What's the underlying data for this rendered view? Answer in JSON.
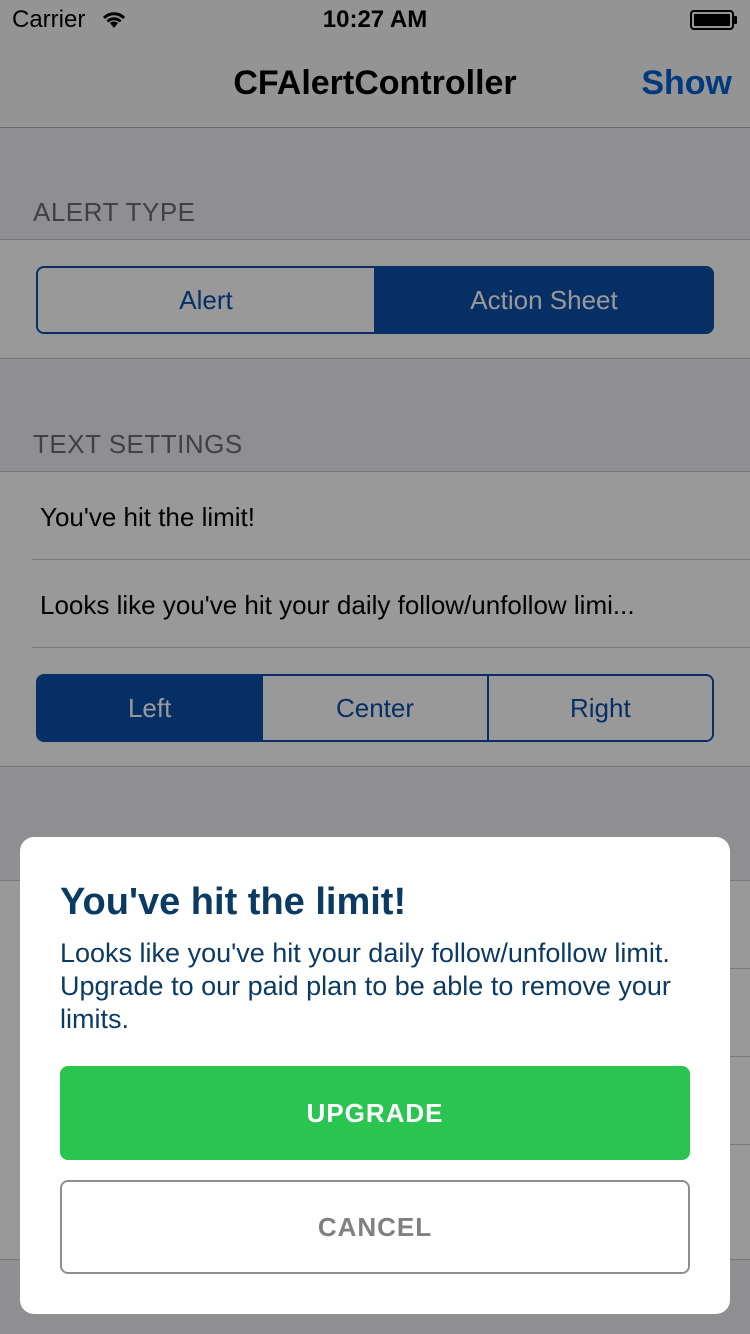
{
  "status_bar": {
    "carrier": "Carrier",
    "time": "10:27 AM",
    "wifi_icon": "wifi-icon",
    "battery_icon": "battery-icon"
  },
  "nav": {
    "title": "CFAlertController",
    "show_label": "Show"
  },
  "alert_type": {
    "header": "ALERT TYPE",
    "options": [
      "Alert",
      "Action Sheet"
    ],
    "selected": "Action Sheet"
  },
  "text_settings": {
    "header": "TEXT SETTINGS",
    "title_value": "You've hit the limit!",
    "message_value": "Looks like you've hit your daily follow/unfollow limi...",
    "alignment_options": [
      "Left",
      "Center",
      "Right"
    ],
    "alignment_selected": "Left"
  },
  "alert": {
    "title": "You've hit the limit!",
    "message": "Looks like you've hit your daily follow/unfollow limit. Upgrade to our paid plan to be able to remove your limits.",
    "upgrade_label": "UPGRADE",
    "cancel_label": "CANCEL"
  },
  "colors": {
    "accent": "#0a4fa8",
    "upgrade_green": "#2ac451",
    "alert_text": "#0b3a63"
  }
}
